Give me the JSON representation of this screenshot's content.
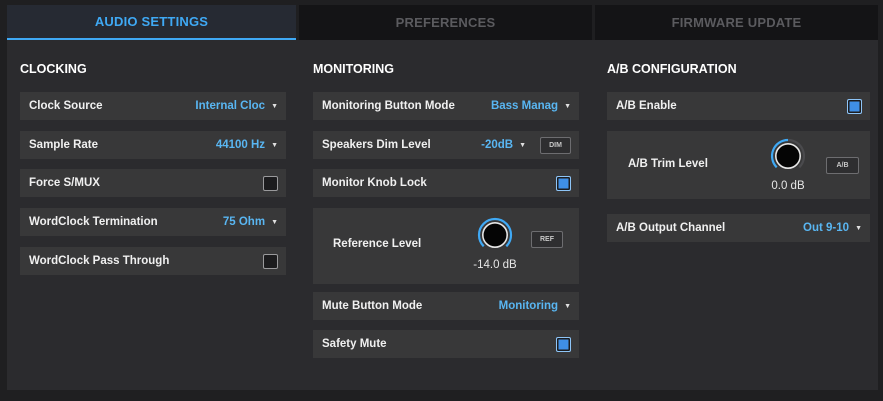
{
  "tabs": [
    {
      "label": "AUDIO SETTINGS",
      "active": true
    },
    {
      "label": "PREFERENCES",
      "active": false
    },
    {
      "label": "FIRMWARE UPDATE",
      "active": false
    }
  ],
  "clocking": {
    "title": "CLOCKING",
    "clock_source": {
      "label": "Clock Source",
      "value": "Internal Cloc"
    },
    "sample_rate": {
      "label": "Sample Rate",
      "value": "44100 Hz"
    },
    "force_smux": {
      "label": "Force S/MUX",
      "checked": false
    },
    "wordclock_termination": {
      "label": "WordClock Termination",
      "value": "75 Ohm"
    },
    "wordclock_pass_through": {
      "label": "WordClock Pass Through",
      "checked": false
    }
  },
  "monitoring": {
    "title": "MONITORING",
    "monitoring_button_mode": {
      "label": "Monitoring Button Mode",
      "value": "Bass Manag"
    },
    "speakers_dim_level": {
      "label": "Speakers Dim Level",
      "value": "-20dB",
      "button": "DIM"
    },
    "monitor_knob_lock": {
      "label": "Monitor Knob Lock",
      "checked": true
    },
    "reference_level": {
      "label": "Reference Level",
      "value": "-14.0 dB",
      "button": "REF"
    },
    "mute_button_mode": {
      "label": "Mute Button Mode",
      "value": "Monitoring"
    },
    "safety_mute": {
      "label": "Safety Mute",
      "checked": true
    }
  },
  "ab": {
    "title": "A/B CONFIGURATION",
    "ab_enable": {
      "label": "A/B Enable",
      "checked": true
    },
    "ab_trim_level": {
      "label": "A/B Trim Level",
      "value": "0.0 dB",
      "button": "A/B"
    },
    "ab_output_channel": {
      "label": "A/B Output Channel",
      "value": "Out 9-10"
    }
  },
  "icons": {
    "dropdown_arrow": "▼"
  },
  "colors": {
    "accent": "#3fa9f5",
    "value_text": "#59b6f2",
    "checkbox_on": "#3f8fe6"
  }
}
